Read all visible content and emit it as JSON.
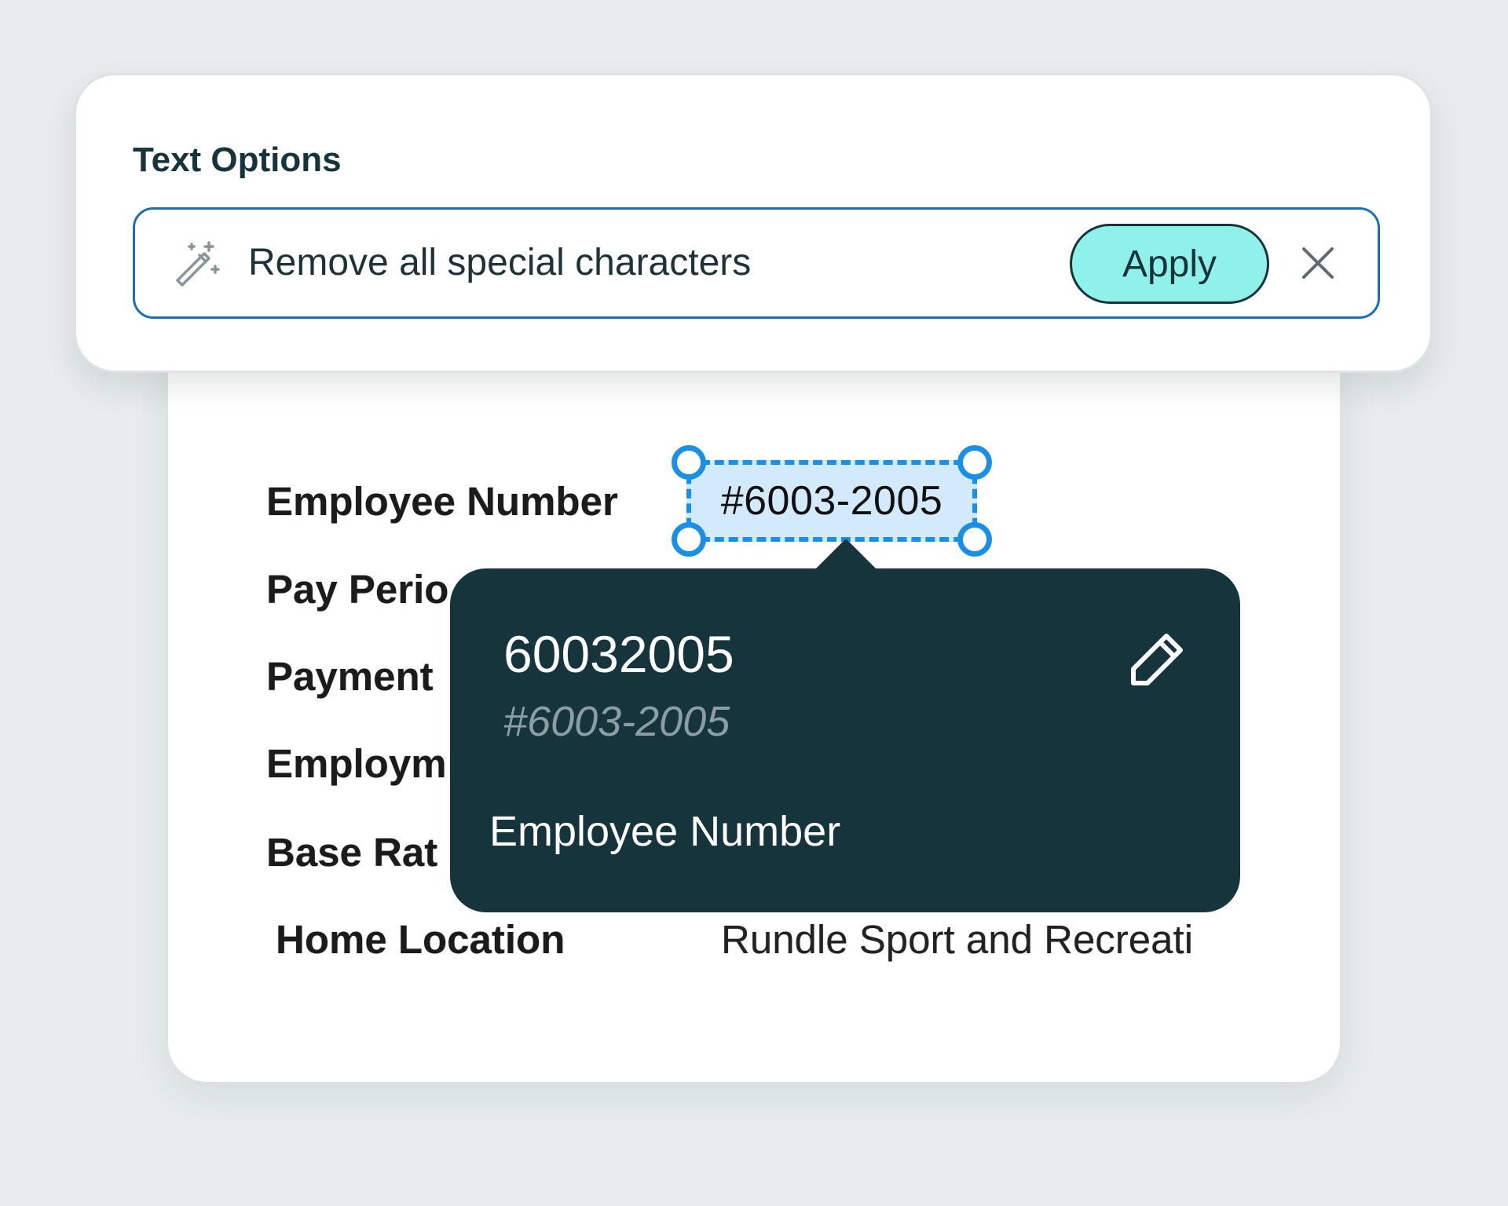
{
  "options_panel": {
    "title": "Text Options",
    "input_text": "Remove all special characters",
    "apply_label": "Apply",
    "icons": {
      "input_icon": "magic-wand-icon",
      "close_icon": "close-icon"
    }
  },
  "document": {
    "fields": [
      {
        "label": "Employee Number",
        "value": "#6003-2005"
      },
      {
        "label": "Pay Perio",
        "value": ""
      },
      {
        "label": "Payment",
        "value": ""
      },
      {
        "label": "Employm",
        "value": ""
      },
      {
        "label": "Base Rat",
        "value": ""
      },
      {
        "label": "Home Location",
        "value": "Rundle Sport and Recreati"
      }
    ],
    "selected_field_index": 0
  },
  "popover": {
    "cleaned_value": "60032005",
    "original_value": "#6003-2005",
    "field_name": "Employee Number",
    "edit_icon": "pencil-icon"
  },
  "colors": {
    "accent_blue": "#1a8fe8",
    "apply_fill": "#8ff1ea",
    "dark_teal": "#16343c",
    "muted_text": "#8a9ea4"
  }
}
